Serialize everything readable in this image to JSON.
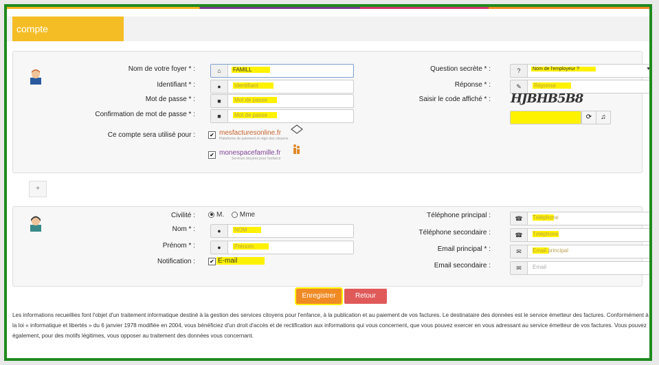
{
  "header": {
    "title": "compte"
  },
  "account": {
    "foyer_label": "Nom de votre foyer * :",
    "foyer_value": "FAMILL",
    "identifiant_label": "Identifiant * :",
    "identifiant_placeholder": "Identifiant",
    "password_label": "Mot de passe * :",
    "password_placeholder": "Mot de passe",
    "confirm_label": "Confirmation de mot de passe * :",
    "confirm_placeholder": "Mot de passe",
    "usage_label": "Ce compte sera utilisé pour :",
    "service1_name": "mesfacturesonline.fr",
    "service1_tag": "Plateforme de paiement et régie des citoyens",
    "service2_name": "monespacefamille.fr",
    "service2_tag": "Services citoyens pour l'enfance",
    "secret_label": "Question secrète * :",
    "secret_value": "Nom de l'employeur ?",
    "answer_label": "Réponse * :",
    "answer_placeholder": "Réponse",
    "captcha_label": "Saisir le code affiché * :",
    "captcha_text": "HJBHB5B8"
  },
  "person": {
    "civility_label": "Civilité :",
    "civility_m": "M.",
    "civility_mme": "Mme",
    "nom_label": "Nom * :",
    "nom_placeholder": "NOM",
    "prenom_label": "Prénom * :",
    "prenom_placeholder": "Prénom",
    "notification_label": "Notification :",
    "notification_option": "E-mail",
    "tel1_label": "Téléphone principal :",
    "tel1_placeholder": "Téléphone",
    "tel2_label": "Téléphone secondaire :",
    "tel2_placeholder": "Téléphone",
    "email1_label": "Email principal * :",
    "email1_placeholder": "Email principal",
    "email2_label": "Email secondaire :",
    "email2_placeholder": "Email"
  },
  "tabs": {
    "add_label": "+"
  },
  "buttons": {
    "save": "Enregistrer",
    "back": "Retour"
  },
  "legal": "Les informations recueillies font l'objet d'un traitement informatique destiné à la gestion des services citoyens pour l'enfance, à la publication et au paiement de vos factures. Le destinataire des données est le service émetteur des factures. Conformément à la loi « informatique et libertés » du 6 janvier 1978 modifiée en 2004, vous bénéficiez d'un droit d'accès et de rectification aux informations qui vous concernent, que vous pouvez exercer en vous adressant au service émetteur de vos factures. Vous pouvez également, pour des motifs légitimes, vous opposer au traitement des données vous concernant.",
  "colors": {
    "frame": "#1f8a1f",
    "tab": "#f5bd25",
    "save": "#f08a24",
    "back": "#e05a5a",
    "highlight": "#fff200"
  }
}
